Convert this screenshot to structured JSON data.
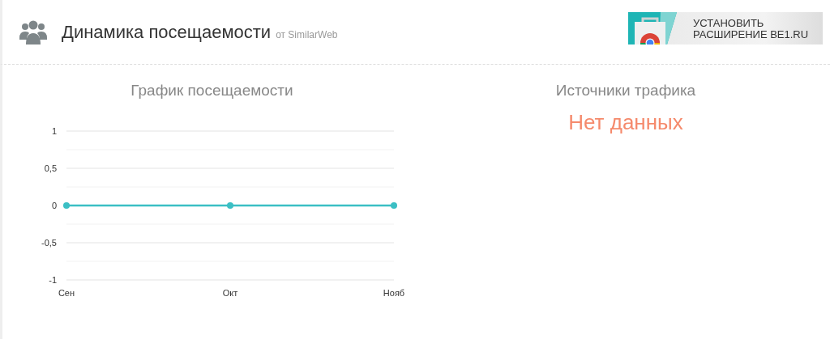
{
  "header": {
    "title": "Динамика посещаемости",
    "subtitle": "от SimilarWeb",
    "banner": {
      "line_1": "УСТАНОВИТЬ",
      "line_2": "РАСШИРЕНИЕ BE1.RU"
    }
  },
  "traffic_panel": {
    "title": "График посещаемости",
    "chart_data": {
      "type": "line",
      "categories": [
        "Сен",
        "Окт",
        "Нояб"
      ],
      "ylim": [
        -1,
        1
      ],
      "yticks": [
        {
          "value": 1,
          "label": "1"
        },
        {
          "value": 0.5,
          "label": "0,5"
        },
        {
          "value": 0,
          "label": "0"
        },
        {
          "value": -0.5,
          "label": "-0,5"
        },
        {
          "value": -1,
          "label": "-1"
        }
      ],
      "series": [
        {
          "color": "#3bbfc4",
          "marker": true,
          "values": [
            0,
            0,
            0
          ]
        }
      ]
    }
  },
  "sources_panel": {
    "title": "Источники трафика",
    "message": "Нет данных"
  }
}
